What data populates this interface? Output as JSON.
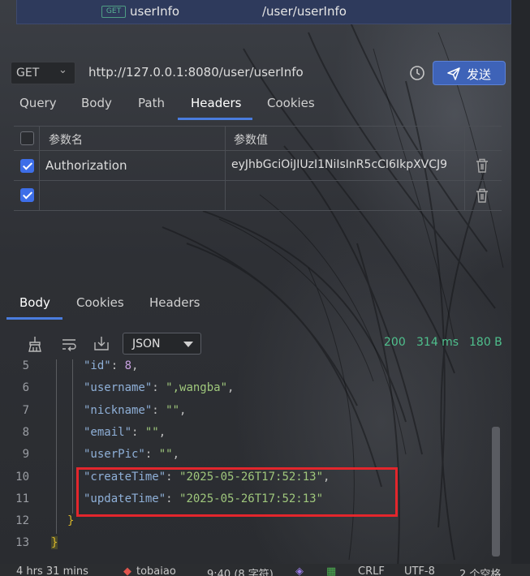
{
  "top_bar": {
    "method_badge": "GET",
    "request_name": "userInfo",
    "request_path": "/user/userInfo"
  },
  "request": {
    "method": "GET",
    "url": "http://127.0.0.1:8080/user/userInfo",
    "send_label": "发送"
  },
  "request_tabs": [
    "Query",
    "Body",
    "Path",
    "Headers",
    "Cookies"
  ],
  "active_request_tab": "Headers",
  "headers_table": {
    "col_name": "参数名",
    "col_value": "参数值",
    "rows": [
      {
        "enabled": true,
        "name": "Authorization",
        "value": "eyJhbGciOiJIUzI1NiIsInR5cCI6IkpXVCJ9"
      },
      {
        "enabled": true,
        "name": "",
        "value": ""
      }
    ]
  },
  "response_tabs": [
    "Body",
    "Cookies",
    "Headers"
  ],
  "active_response_tab": "Body",
  "response_meta": {
    "format": "JSON",
    "status_code": "200",
    "time": "314 ms",
    "size": "180 B"
  },
  "code_lines": [
    {
      "num": "5",
      "key": "\"id\"",
      "value": "8",
      "value_type": "number",
      "comma": true
    },
    {
      "num": "6",
      "key": "\"username\"",
      "value": "\",wangba\"",
      "value_type": "string",
      "comma": true
    },
    {
      "num": "7",
      "key": "\"nickname\"",
      "value": "\"\"",
      "value_type": "string",
      "comma": true
    },
    {
      "num": "8",
      "key": "\"email\"",
      "value": "\"\"",
      "value_type": "string",
      "comma": true
    },
    {
      "num": "9",
      "key": "\"userPic\"",
      "value": "\"\"",
      "value_type": "string",
      "comma": true
    },
    {
      "num": "10",
      "key": "\"createTime\"",
      "value": "\"2025-05-26T17:52:13\"",
      "value_type": "string",
      "comma": true
    },
    {
      "num": "11",
      "key": "\"updateTime\"",
      "value": "\"2025-05-26T17:52:13\"",
      "value_type": "string",
      "comma": false
    }
  ],
  "closing_lines": [
    {
      "num": "12",
      "text": "}"
    },
    {
      "num": "13",
      "text": "}"
    }
  ],
  "status_bar": {
    "time_spent": "4 hrs 31 mins",
    "project": "tobaiao",
    "cursor": "9:40 (8 字符)",
    "line_ending": "CRLF",
    "encoding": "UTF-8",
    "indent": "2 个空格"
  },
  "colors": {
    "accent": "#4a7cde",
    "send_button": "#3e63b8",
    "status_ok": "#4fc08d",
    "highlight_box": "#e3262c"
  }
}
